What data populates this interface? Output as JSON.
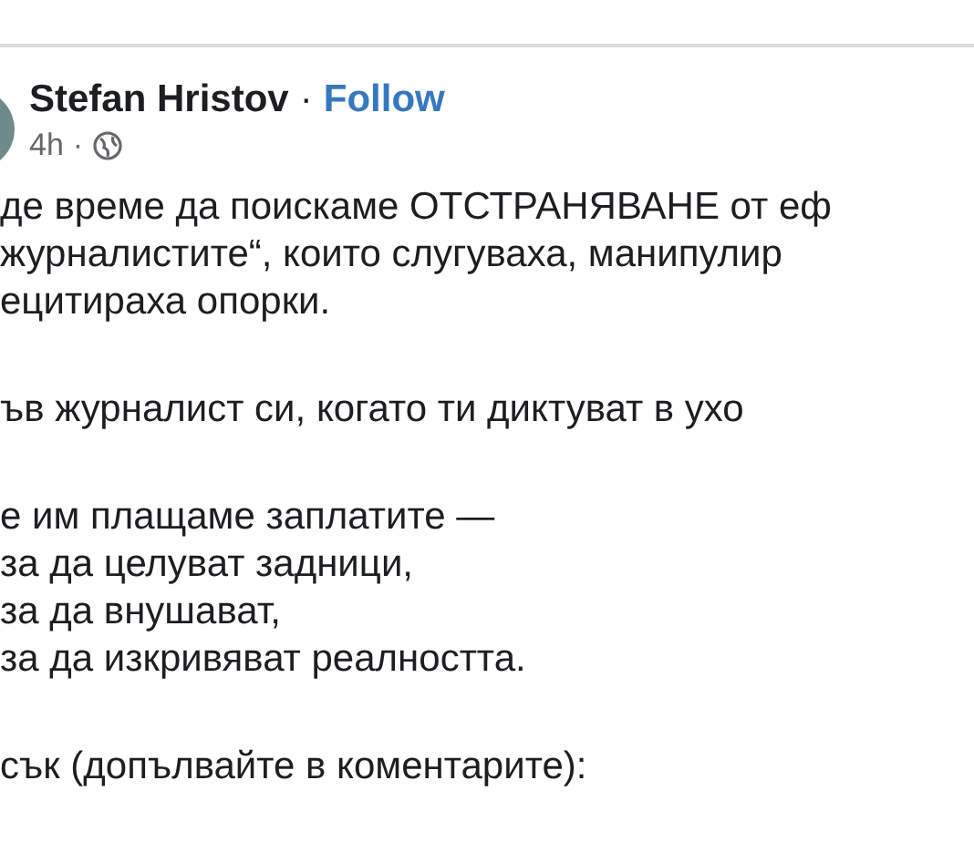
{
  "post": {
    "author": "Stefan Hristov",
    "separator": "·",
    "follow": "Follow",
    "time": "4h",
    "time_separator": "·",
    "paragraphs": [
      [
        "де време да поискаме ОТСТРАНЯВАНЕ от еф",
        "журналистите“, които слугуваха, манипулир",
        "ецитираха опорки."
      ],
      [
        "ъв журналист си, когато ти диктуват в ухо"
      ],
      [
        "е им плащаме заплатите —",
        "за да целуват задници,",
        "за да внушават,",
        "за да изкривяват реалността."
      ],
      [
        "сък (допълвайте в коментарите):"
      ]
    ]
  }
}
